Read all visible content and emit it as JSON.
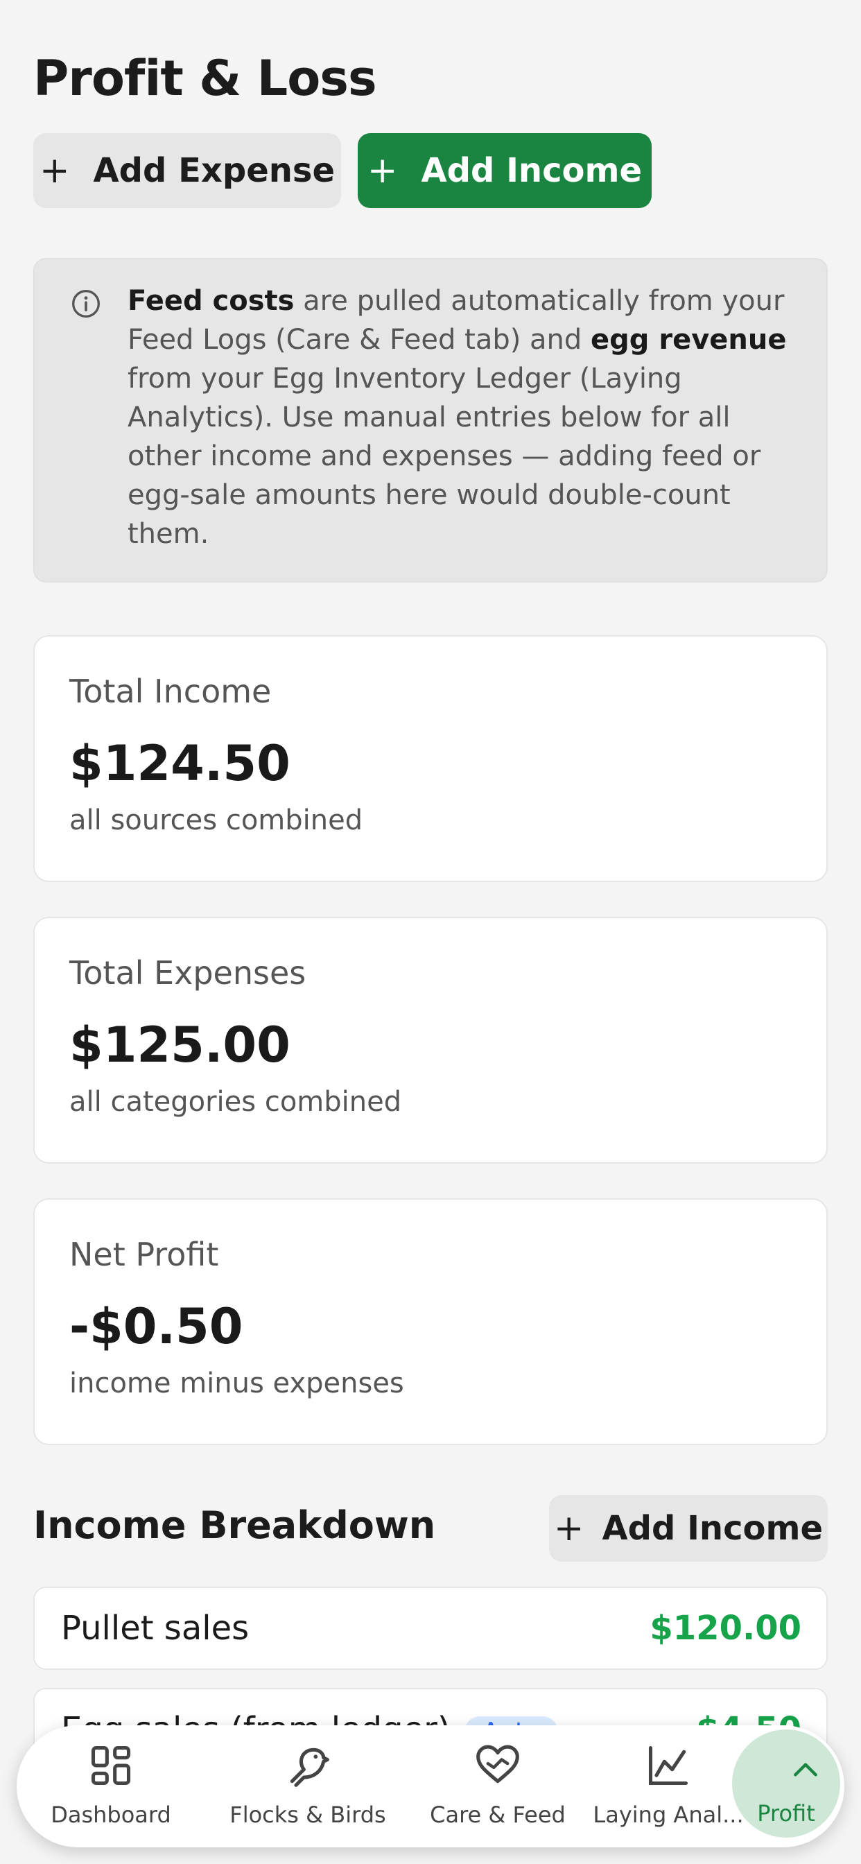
{
  "page": {
    "title": "Profit & Loss"
  },
  "actions": {
    "add_expense_label": "Add Expense",
    "add_income_label": "Add Income"
  },
  "info_box": {
    "icon": "info-icon",
    "bold_1": "Feed costs",
    "text_1": " are pulled automatically from your Feed Logs (Care & Feed tab) and ",
    "bold_2": "egg revenue",
    "text_2": " from your Egg Inventory Ledger (Laying Analytics). Use manual entries below for all other income and expenses — adding feed or egg-sale amounts here would double-count them."
  },
  "summary": [
    {
      "label": "Total Income",
      "value": "$124.50",
      "sub": "all sources combined"
    },
    {
      "label": "Total Expenses",
      "value": "$125.00",
      "sub": "all categories combined"
    },
    {
      "label": "Net Profit",
      "value": "-$0.50",
      "sub": "income minus expenses"
    }
  ],
  "income_breakdown": {
    "title": "Income Breakdown",
    "add_label": "Add Income",
    "rows": [
      {
        "label": "Pullet sales",
        "value": "$120.00"
      },
      {
        "label": "Egg sales (from ledger)",
        "tag": "Auto",
        "value": "$4.50"
      }
    ]
  },
  "nav": {
    "items": [
      {
        "label": "Dashboard",
        "icon": "dashboard-grid-icon"
      },
      {
        "label": "Flocks & Birds",
        "icon": "bird-icon"
      },
      {
        "label": "Care & Feed",
        "icon": "heart-hand-icon"
      },
      {
        "label": "Laying Anal...",
        "icon": "line-chart-icon"
      },
      {
        "label": "Profit",
        "icon": "chevron-up-icon"
      }
    ],
    "active": "Profit"
  },
  "colors": {
    "accent": "#1a8540",
    "income_value": "#16a34a",
    "background": "#f4f4f4",
    "card": "#ffffff",
    "muted_text": "#555555"
  }
}
